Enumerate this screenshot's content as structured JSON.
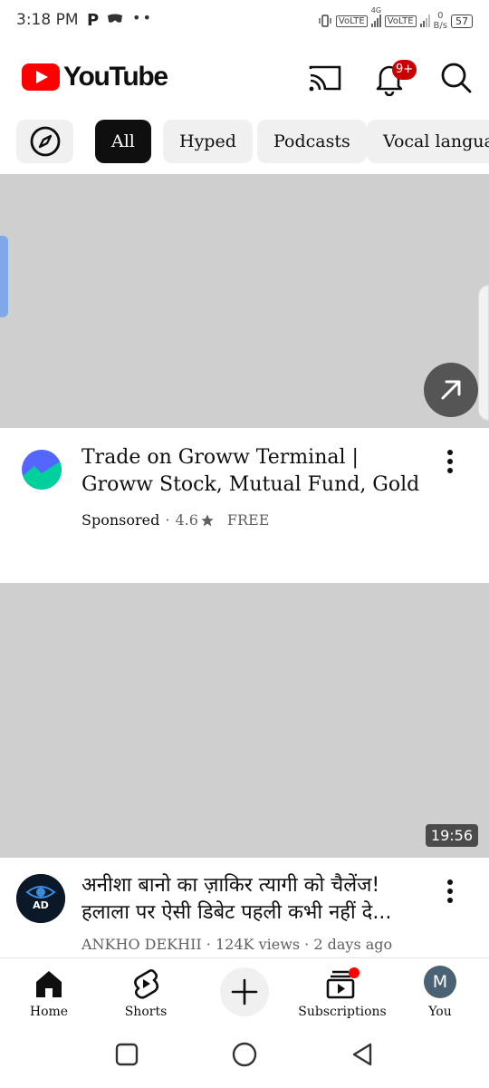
{
  "status_bar": {
    "time": "3:18 PM",
    "p_icon": "P",
    "dots": "••",
    "volte1": "VoLTE",
    "volte2": "VoLTE",
    "net_type": "4G",
    "speed_value": "0",
    "speed_unit": "B/s",
    "battery": "57"
  },
  "header": {
    "logo_text": "YouTube",
    "notification_badge": "9+"
  },
  "chips": [
    {
      "label": ""
    },
    {
      "label": "All"
    },
    {
      "label": "Hyped"
    },
    {
      "label": "Podcasts"
    },
    {
      "label": "Vocal languag"
    }
  ],
  "ad": {
    "title": "Trade on Groww Terminal | Groww Stock, Mutual Fund, Gold",
    "sponsored": "Sponsored",
    "rating": "4.6",
    "price": "FREE",
    "separator": "·"
  },
  "video": {
    "duration": "19:56",
    "title_line1": "अनीशा बानो का ज़ाकिर त्यागी को चैलेंज!",
    "title_line2": "हलाला पर ऐसी डिबेट पहली कभी नहीं दे...",
    "channel": "ANKHO DEKHII",
    "views": "124K views",
    "age": "2 days ago",
    "avatar_text": "AD",
    "meta_sep": " · "
  },
  "bottom_nav": {
    "home": "Home",
    "shorts": "Shorts",
    "subscriptions": "Subscriptions",
    "you": "You",
    "you_initial": "M"
  },
  "colors": {
    "brand_red": "#ff0000",
    "badge_red": "#cc0000",
    "chip_bg": "#f0f0f0",
    "chip_active": "#0f0f0f",
    "placeholder": "#cfcfcf"
  }
}
